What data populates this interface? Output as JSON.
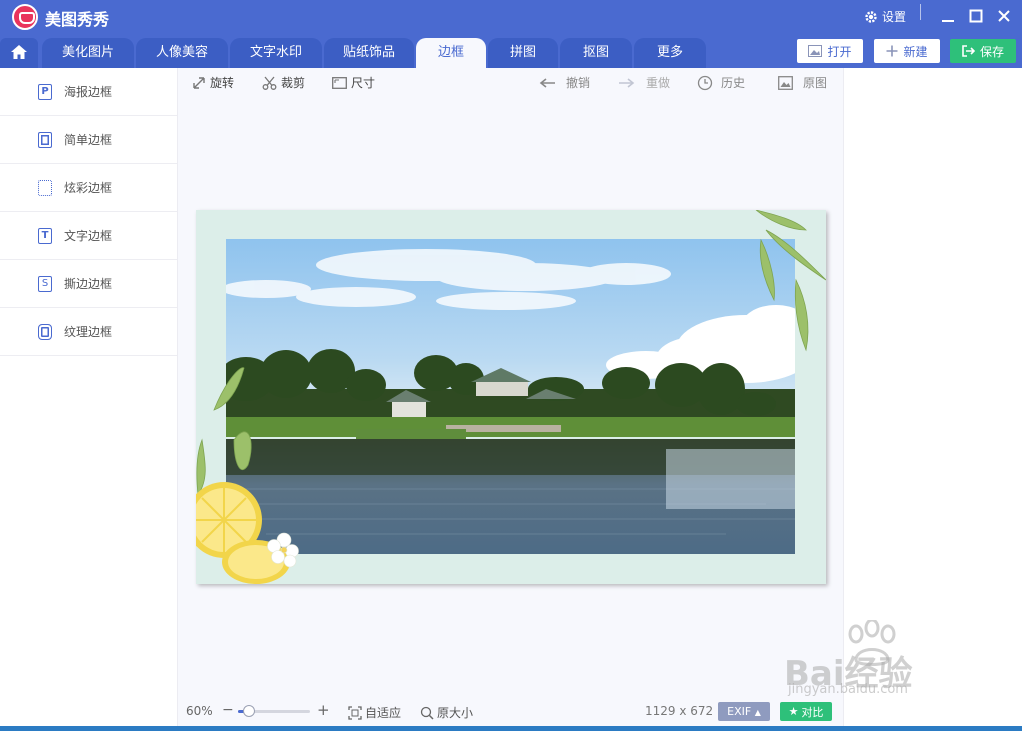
{
  "app": {
    "title": "美图秀秀"
  },
  "window": {
    "settings_label": "设置"
  },
  "tabs": [
    {
      "label": "美化图片"
    },
    {
      "label": "人像美容"
    },
    {
      "label": "文字水印"
    },
    {
      "label": "贴纸饰品"
    },
    {
      "label": "边框",
      "active": true
    },
    {
      "label": "拼图"
    },
    {
      "label": "抠图"
    },
    {
      "label": "更多"
    }
  ],
  "header_buttons": {
    "open": "打开",
    "new": "新建",
    "save": "保存"
  },
  "sidebar": {
    "items": [
      {
        "label": "海报边框",
        "icon": "poster-frame-icon",
        "glyph": "P"
      },
      {
        "label": "简单边框",
        "icon": "simple-frame-icon",
        "glyph": ""
      },
      {
        "label": "炫彩边框",
        "icon": "colorful-frame-icon",
        "glyph": ""
      },
      {
        "label": "文字边框",
        "icon": "text-frame-icon",
        "glyph": "T"
      },
      {
        "label": "撕边边框",
        "icon": "torn-frame-icon",
        "glyph": "S"
      },
      {
        "label": "纹理边框",
        "icon": "texture-frame-icon",
        "glyph": ""
      }
    ]
  },
  "toolbar": {
    "rotate": "旋转",
    "crop": "裁剪",
    "size": "尺寸",
    "undo": "撤销",
    "redo": "重做",
    "history": "历史",
    "original": "原图"
  },
  "status": {
    "zoom": "60%",
    "zoom_level": 0.15,
    "fit": "自适应",
    "actual_size": "原大小",
    "dimensions": "1129 x 672",
    "exif": "EXIF",
    "compare": "对比"
  },
  "watermark": {
    "brand": "Bai经验",
    "site": "jingyan.baidu.com"
  },
  "colors": {
    "brand": "#4a6ad0",
    "save": "#2ec07a",
    "active_tab_bg": "#f7f8fd"
  }
}
